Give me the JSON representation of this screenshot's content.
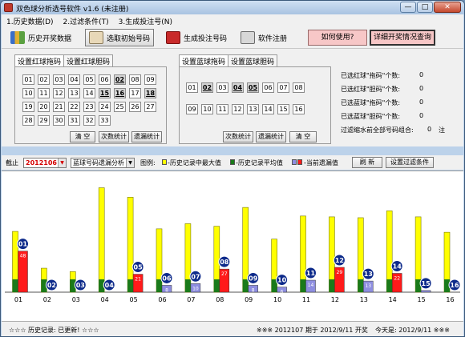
{
  "window": {
    "title": "双色球分析选号软件 v1.6  (未注册)",
    "btn_min": "—",
    "btn_max": "□",
    "btn_close": "✕"
  },
  "menu": [
    "1.历史数据(D)",
    "2.过滤条件(T)",
    "3.生成投注号(N)"
  ],
  "toolbar": {
    "history": "历史开奖数据",
    "pick": "选取初始号码",
    "generate": "生成投注号码",
    "register": "软件注册",
    "howto": "如何使用?",
    "detail": "详细开奖情况查询"
  },
  "red_panel": {
    "tab_drag": "设置红球拖码",
    "tab_gall": "设置红球胆码",
    "numbers": [
      "01",
      "02",
      "03",
      "04",
      "05",
      "06",
      "02",
      "08",
      "09",
      "10",
      "11",
      "12",
      "13",
      "14",
      "15",
      "16",
      "17",
      "18",
      "19",
      "20",
      "21",
      "22",
      "23",
      "24",
      "25",
      "26",
      "27",
      "28",
      "29",
      "30",
      "31",
      "32",
      "33"
    ],
    "selected": [
      6,
      14,
      15,
      17
    ],
    "btn_clear": "清 空",
    "btn_stats": "次数统计",
    "btn_omit": "遗漏统计"
  },
  "blue_panel": {
    "tab_drag": "设置蓝球拖码",
    "tab_gall": "设置蓝球胆码",
    "numbers": [
      "01",
      "02",
      "03",
      "04",
      "05",
      "06",
      "07",
      "08",
      "09",
      "10",
      "11",
      "12",
      "13",
      "14",
      "15",
      "16"
    ],
    "selected": [
      1,
      3,
      4
    ],
    "btn_stats": "次数统计",
    "btn_omit": "遗漏统计",
    "btn_clear": "清 空"
  },
  "stats": [
    {
      "label": "已选红球\"拖码\"个数:",
      "value": "0"
    },
    {
      "label": "已选红球\"胆码\"个数:",
      "value": "0"
    },
    {
      "label": "已选蓝球\"拖码\"个数:",
      "value": "0"
    },
    {
      "label": "已选蓝球\"胆码\"个数:",
      "value": "0"
    },
    {
      "label": "过滤缩水前全部号码组合:",
      "value": "0",
      "unit": "注"
    }
  ],
  "controls": {
    "cutoff": "截止",
    "period": "2012106",
    "stat_type": "蓝球号码遗漏分析",
    "legend_title": "图例:",
    "legend_max": "-历史记录中最大值",
    "legend_avg": "-历史记录平均值",
    "legend_cur": "-当前遗漏值",
    "btn_refresh": "刷 新",
    "btn_filter": "设置过滤条件"
  },
  "colors": {
    "max": "#ffff00",
    "avg": "#1a7a1a",
    "cur_red": "#ff1a1a",
    "cur_blue": "#8e8ee0",
    "ball": "#0d2a8a"
  },
  "chart_data": {
    "type": "bar",
    "categories": [
      "01",
      "02",
      "03",
      "04",
      "05",
      "06",
      "07",
      "08",
      "09",
      "10",
      "11",
      "12",
      "13",
      "14",
      "15",
      "16"
    ],
    "series": [
      {
        "name": "历史记录中最大值",
        "values": [
          71,
          28,
          24,
          122,
          111,
          74,
          80,
          77,
          99,
          62,
          89,
          88,
          87,
          95,
          88,
          70
        ]
      },
      {
        "name": "历史记录平均值",
        "values": [
          15,
          15,
          15,
          15,
          15,
          15,
          15,
          15,
          15,
          15,
          15,
          15,
          15,
          15,
          15,
          15
        ]
      },
      {
        "name": "当前遗漏值",
        "values": [
          48,
          0,
          0,
          0,
          21,
          8,
          10,
          27,
          8,
          6,
          14,
          29,
          13,
          22,
          2,
          0
        ]
      }
    ],
    "bar_labels": [
      "48",
      "",
      "",
      "",
      "21",
      "8",
      "10",
      "27",
      "8",
      "6",
      "14",
      "29",
      "13",
      "22",
      "",
      ""
    ],
    "ylim": [
      0,
      130
    ]
  },
  "statusbar": {
    "left": "☆☆☆  历史记录:  已更新!  ☆☆☆",
    "mid": "※※※  2012107 期于 2012/9/11 开奖",
    "right": "今天是:  2012/9/11  ※※※"
  }
}
